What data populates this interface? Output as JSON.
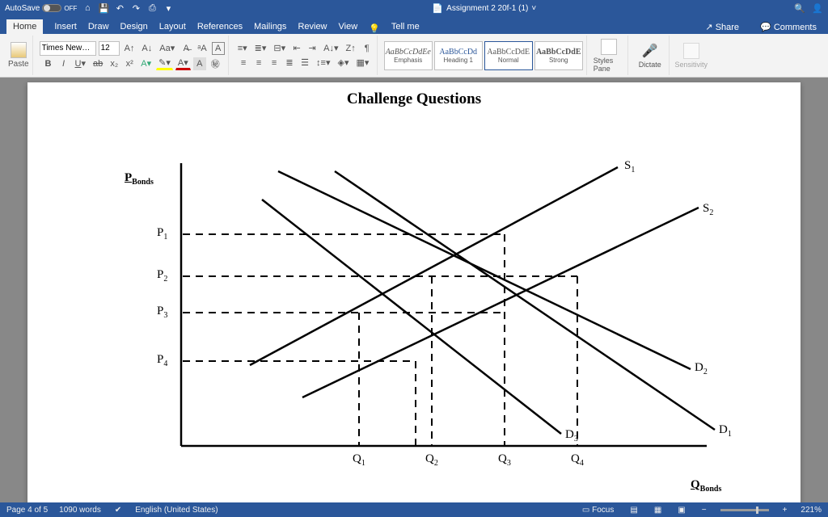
{
  "titlebar": {
    "autosave_label": "AutoSave",
    "autosave_state": "OFF",
    "doc_title": "Assignment 2 20f-1 (1)"
  },
  "tabs": {
    "home": "Home",
    "insert": "Insert",
    "draw": "Draw",
    "design": "Design",
    "layout": "Layout",
    "references": "References",
    "mailings": "Mailings",
    "review": "Review",
    "view": "View",
    "tellme": "Tell me",
    "share": "Share",
    "comments": "Comments"
  },
  "ribbon": {
    "paste": "Paste",
    "font_name": "Times New…",
    "font_size": "12",
    "styles": [
      {
        "preview": "AaBbCcDdEe",
        "name": "Emphasis"
      },
      {
        "preview": "AaBbCcDd",
        "name": "Heading 1"
      },
      {
        "preview": "AaBbCcDdE",
        "name": "Normal"
      },
      {
        "preview": "AaBbCcDdE",
        "name": "Strong"
      }
    ],
    "styles_pane": "Styles Pane",
    "dictate": "Dictate",
    "sensitivity": "Sensitivity"
  },
  "document": {
    "title": "Challenge Questions",
    "y_axis_label": "P",
    "y_axis_sub": "Bonds",
    "x_axis_label": "Q",
    "x_axis_sub": "Bonds",
    "p_labels": [
      "P",
      "P",
      "P",
      "P"
    ],
    "p_subs": [
      "1",
      "2",
      "3",
      "4"
    ],
    "q_labels": [
      "Q",
      "Q",
      "Q",
      "Q"
    ],
    "q_subs": [
      "1",
      "2",
      "3",
      "4"
    ],
    "s_labels": [
      "S",
      "S"
    ],
    "s_subs": [
      "1",
      "2"
    ],
    "d_labels": [
      "D",
      "D",
      "D"
    ],
    "d_subs": [
      "1",
      "2",
      "3"
    ]
  },
  "chart_data": {
    "type": "line",
    "title": "Challenge Questions",
    "xlabel": "Q_Bonds",
    "ylabel": "P_Bonds",
    "x_ticks": [
      "Q1",
      "Q2",
      "Q3",
      "Q4"
    ],
    "y_ticks": [
      "P1",
      "P2",
      "P3",
      "P4"
    ],
    "series": [
      {
        "name": "S1",
        "type": "supply"
      },
      {
        "name": "S2",
        "type": "supply"
      },
      {
        "name": "D1",
        "type": "demand"
      },
      {
        "name": "D2",
        "type": "demand"
      },
      {
        "name": "D3",
        "type": "demand"
      }
    ],
    "intersections_guide_to_axis": [
      "Q1",
      "Q2",
      "Q3",
      "Q4",
      "P1",
      "P2",
      "P3",
      "P4"
    ]
  },
  "statusbar": {
    "page": "Page 4 of 5",
    "words": "1090 words",
    "lang": "English (United States)",
    "focus": "Focus",
    "zoom": "221%"
  }
}
